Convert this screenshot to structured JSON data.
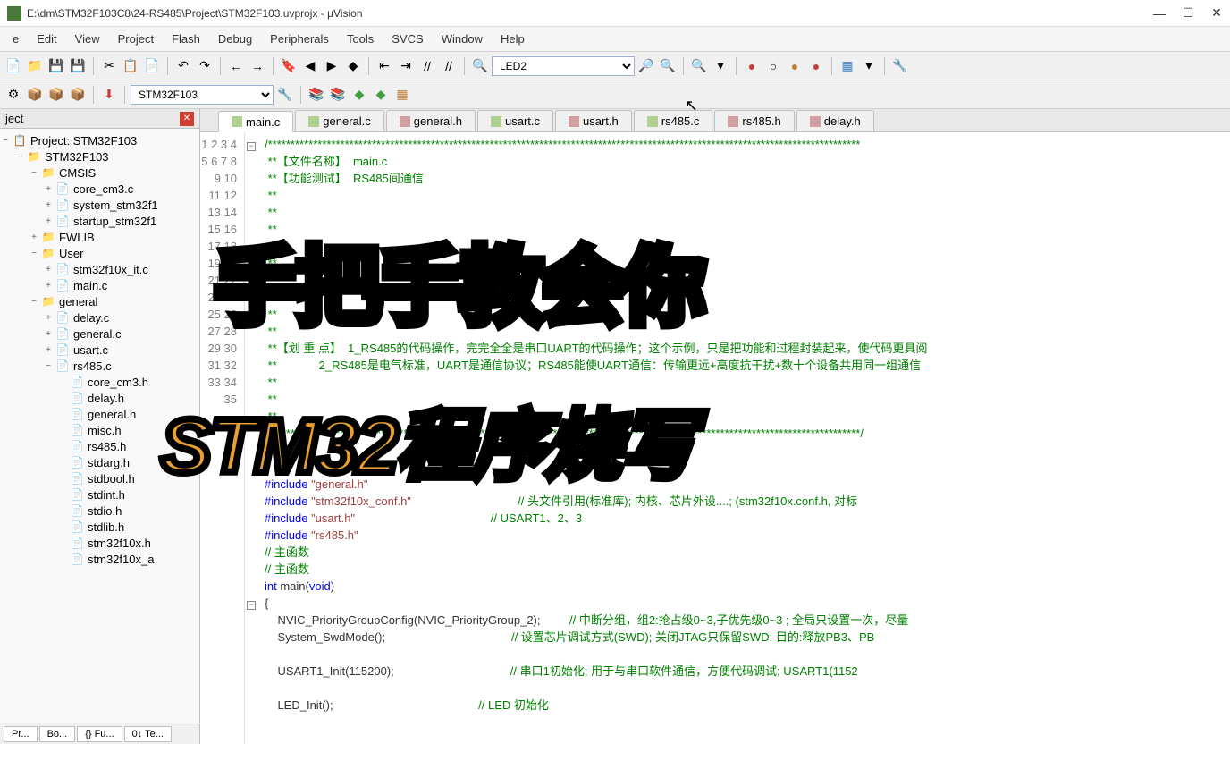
{
  "title": "E:\\dm\\STM32F103C8\\24-RS485\\Project\\STM32F103.uvprojx - µVision",
  "menu": [
    "e",
    "Edit",
    "View",
    "Project",
    "Flash",
    "Debug",
    "Peripherals",
    "Tools",
    "SVCS",
    "Window",
    "Help"
  ],
  "toolbar_select": "LED2",
  "target_select": "STM32F103",
  "project_panel_title": "ject",
  "tree": {
    "root": "Project: STM32F103",
    "target": "STM32F103",
    "groups": [
      {
        "name": "CMSIS",
        "exp": "−",
        "files": [
          "core_cm3.c",
          "system_stm32f1",
          "startup_stm32f1"
        ]
      },
      {
        "name": "FWLIB",
        "exp": "+",
        "files": []
      },
      {
        "name": "User",
        "exp": "−",
        "files": [
          "stm32f10x_it.c",
          "main.c"
        ]
      },
      {
        "name": "general",
        "exp": "−",
        "files": [
          "delay.c",
          "general.c",
          "usart.c"
        ],
        "sub": {
          "name": "rs485.c",
          "files": [
            "core_cm3.h",
            "delay.h",
            "general.h",
            "misc.h",
            "rs485.h",
            "stdarg.h",
            "stdbool.h",
            "stdint.h",
            "stdio.h",
            "stdlib.h",
            "stm32f10x.h",
            "stm32f10x_a"
          ]
        }
      }
    ]
  },
  "tabs": [
    {
      "name": "main.c",
      "type": "c",
      "active": true
    },
    {
      "name": "general.c",
      "type": "c"
    },
    {
      "name": "general.h",
      "type": "h"
    },
    {
      "name": "usart.c",
      "type": "c"
    },
    {
      "name": "usart.h",
      "type": "h"
    },
    {
      "name": "rs485.c",
      "type": "c"
    },
    {
      "name": "rs485.h",
      "type": "h"
    },
    {
      "name": "delay.h",
      "type": "h"
    }
  ],
  "code_lines": [
    {
      "n": 1,
      "fold": "−",
      "text": "/***********************************************************************************************************************************",
      "cls": "c-comment"
    },
    {
      "n": 2,
      "text": " **【文件名称】  main.c",
      "cls": "c-comment"
    },
    {
      "n": 3,
      "text": " **【功能测试】  RS485间通信",
      "cls": "c-comment"
    },
    {
      "n": 4,
      "text": " **",
      "cls": "c-comment"
    },
    {
      "n": 5,
      "text": " **",
      "cls": "c-comment"
    },
    {
      "n": 6,
      "text": " **",
      "cls": "c-comment"
    },
    {
      "n": 7,
      "text": " **",
      "cls": "c-comment"
    },
    {
      "n": 8,
      "text": " **",
      "cls": "c-comment"
    },
    {
      "n": 9,
      "text": " **",
      "cls": "c-comment"
    },
    {
      "n": 10,
      "text": " **",
      "cls": "c-comment"
    },
    {
      "n": 11,
      "text": " **",
      "cls": "c-comment"
    },
    {
      "n": 12,
      "text": " **",
      "cls": "c-comment"
    },
    {
      "n": 13,
      "text": " **【划 重 点】  1_RS485的代码操作，完完全全是串口UART的代码操作；这个示例，只是把功能和过程封装起来，使代码更具阅",
      "cls": "c-comment"
    },
    {
      "n": 14,
      "text": " **             2_RS485是电气标准，UART是通信协议；RS485能使UART通信：传输更远+高度抗干扰+数十个设备共用同一组通信",
      "cls": "c-comment"
    },
    {
      "n": 15,
      "text": " **",
      "cls": "c-comment"
    },
    {
      "n": 16,
      "text": " **",
      "cls": "c-comment"
    },
    {
      "n": 17,
      "text": " **",
      "cls": "c-comment"
    },
    {
      "n": 18,
      "text": " ***********************************************************************************************************************************/",
      "cls": "c-comment"
    },
    {
      "n": 19,
      "text": "",
      "cls": ""
    },
    {
      "n": 20,
      "text": "",
      "cls": ""
    },
    {
      "n": 21,
      "text": "#include \"general.h\"",
      "cls": "c-string"
    },
    {
      "n": 22,
      "text": "#include \"stm32f10x_conf.h\"",
      "cls": "c-string",
      "comment": "// 头文件引用(标准库); 内核、芯片外设....; (stm32f10x.conf.h, 对标"
    },
    {
      "n": 23,
      "text": "#include \"usart.h\"",
      "cls": "c-string",
      "comment": "// USART1、2、3"
    },
    {
      "n": 24,
      "text": "#include \"rs485.h\"",
      "cls": "c-string"
    },
    {
      "n": 25,
      "text": "// 主函数",
      "cls": "c-comment"
    },
    {
      "n": 26,
      "text": "// 主函数",
      "cls": "c-comment"
    },
    {
      "n": 27,
      "text": "int main(void)",
      "cls": ""
    },
    {
      "n": 28,
      "fold": "−",
      "text": "{",
      "cls": ""
    },
    {
      "n": 29,
      "text": "    NVIC_PriorityGroupConfig(NVIC_PriorityGroup_2);",
      "comment": "// 中断分组，组2:抢占级0~3,子优先级0~3 ; 全局只设置一次，尽量"
    },
    {
      "n": 30,
      "text": "    System_SwdMode();",
      "comment": "// 设置芯片调试方式(SWD); 关闭JTAG只保留SWD; 目的:释放PB3、PB"
    },
    {
      "n": 31,
      "text": ""
    },
    {
      "n": 32,
      "text": "    USART1_Init(115200);",
      "comment": "// 串口1初始化; 用于与串口软件通信，方便代码调试; USART1(1152"
    },
    {
      "n": 33,
      "text": ""
    },
    {
      "n": 34,
      "text": "    LED_Init();",
      "comment": "// LED 初始化"
    },
    {
      "n": 35,
      "text": ""
    }
  ],
  "bottom_tabs": [
    "Pr...",
    "Bo...",
    "{} Fu...",
    "0↓ Te..."
  ],
  "overlay1": "手把手教会你",
  "overlay2": "STM32程序烧写"
}
